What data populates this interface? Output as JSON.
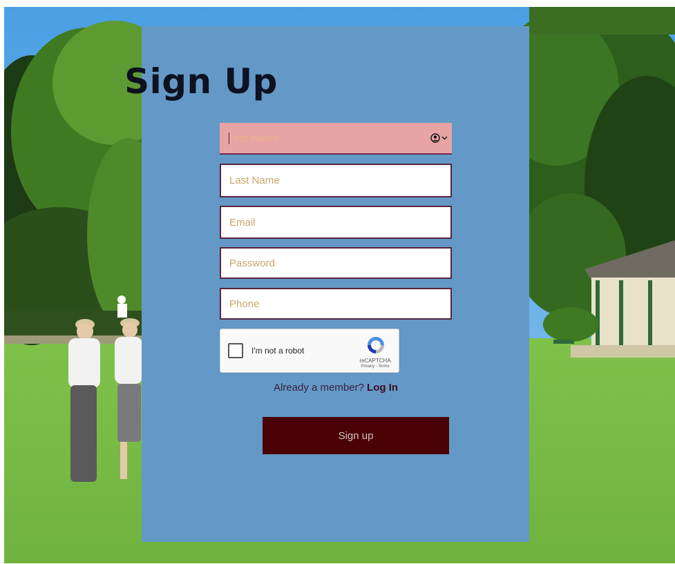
{
  "form": {
    "title": "Sign Up",
    "fields": {
      "first_name": {
        "placeholder": "First Name",
        "value": ""
      },
      "last_name": {
        "placeholder": "Last Name",
        "value": ""
      },
      "email": {
        "placeholder": "Email",
        "value": ""
      },
      "password": {
        "placeholder": "Password",
        "value": ""
      },
      "phone": {
        "placeholder": "Phone",
        "value": ""
      }
    },
    "autofill_icon": "person-circle-icon",
    "captcha": {
      "label": "I'm not a robot",
      "brand": "reCAPTCHA",
      "links": "Privacy - Terms",
      "checked": false
    },
    "member_prompt": "Already a member?",
    "login_label": "Log In",
    "submit_label": "Sign up"
  },
  "colors": {
    "panel": "#6499c7",
    "active_field": "#e8a3a5",
    "submit_button": "#4a0205",
    "placeholder": "#c9a56a"
  }
}
